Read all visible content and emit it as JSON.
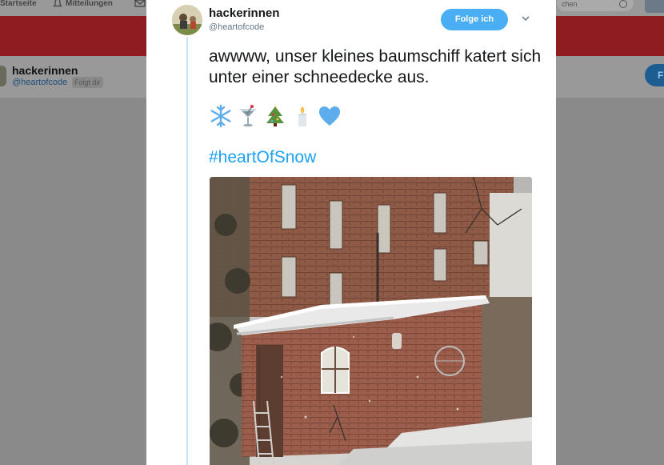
{
  "background": {
    "nav": {
      "home_label": "Startseite",
      "notifications_label": "Mitteilungen",
      "search_placeholder": "chen"
    },
    "profile": {
      "name": "hackerinnen",
      "handle": "@heartofcode",
      "follows_you": "Folgt dir",
      "follow_label": "F"
    },
    "colors": {
      "header_red": "#8f1c20",
      "overlay_gray": "#8a8a8a"
    }
  },
  "tweet": {
    "author_name": "hackerinnen",
    "author_handle": "@heartofcode",
    "follow_button": "Folge ich",
    "text": "awwww, unser kleines baumschiff katert sich unter einer schneedecke aus.",
    "emojis": [
      "snowflake-icon",
      "cocktail-glass-icon",
      "christmas-tree-icon",
      "candle-icon",
      "blue-heart-icon"
    ],
    "hashtag": "#heartOfSnow",
    "colors": {
      "accent": "#1da1f2",
      "follow_button": "#4aaef5",
      "text": "#14171a"
    }
  }
}
